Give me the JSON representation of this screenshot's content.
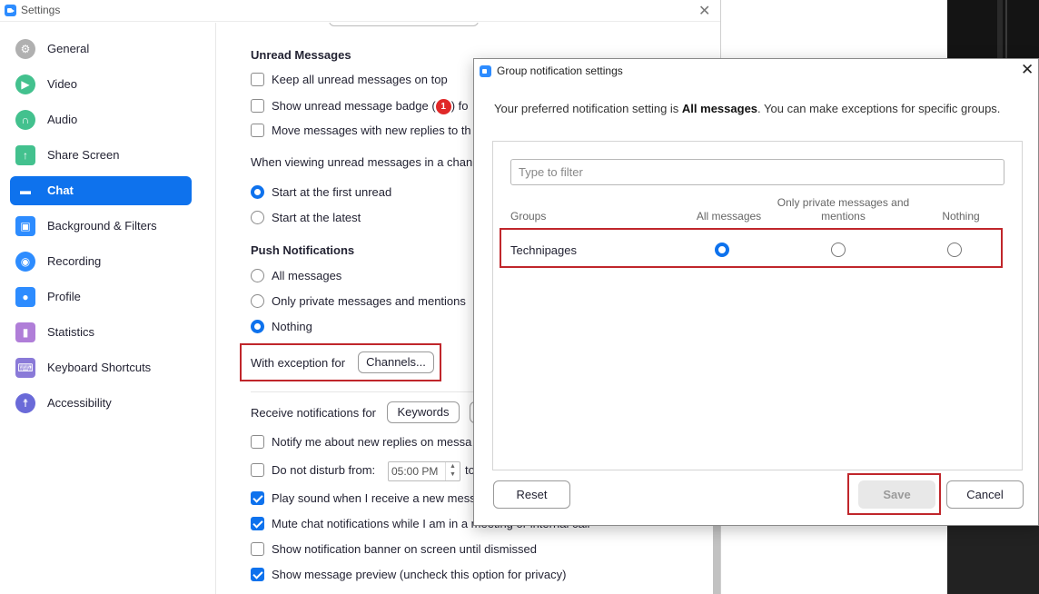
{
  "window": {
    "title": "Settings"
  },
  "sidebar": {
    "items": [
      {
        "label": "General",
        "icon": "gear-icon",
        "color": "#b0b0b0"
      },
      {
        "label": "Video",
        "icon": "video-icon",
        "color": "#43c18e"
      },
      {
        "label": "Audio",
        "icon": "headphones-icon",
        "color": "#43c18e"
      },
      {
        "label": "Share Screen",
        "icon": "share-screen-icon",
        "color": "#43c18e"
      },
      {
        "label": "Chat",
        "icon": "chat-icon",
        "color": "#ffffff"
      },
      {
        "label": "Background & Filters",
        "icon": "background-icon",
        "color": "#2d8cff"
      },
      {
        "label": "Recording",
        "icon": "recording-icon",
        "color": "#2d8cff"
      },
      {
        "label": "Profile",
        "icon": "profile-icon",
        "color": "#2d8cff"
      },
      {
        "label": "Statistics",
        "icon": "statistics-icon",
        "color": "#b07ed8"
      },
      {
        "label": "Keyboard Shortcuts",
        "icon": "keyboard-icon",
        "color": "#8a7ad8"
      },
      {
        "label": "Accessibility",
        "icon": "accessibility-icon",
        "color": "#6a6ad8"
      }
    ],
    "active_index": 4,
    "active_color": "#0e72ed"
  },
  "chat": {
    "unread_title": "Unread Messages",
    "keep_unread": "Keep all unread messages on top",
    "badge_pre": "Show unread message badge (",
    "badge_count": "1",
    "badge_post": ") fo",
    "move_messages": "Move messages with new replies to th",
    "when_viewing": "When viewing unread messages in a chann",
    "start_first": "Start at the first unread",
    "start_latest": "Start at the latest",
    "push_title": "Push Notifications",
    "push_all": "All messages",
    "push_private": "Only private messages and mentions",
    "push_nothing": "Nothing",
    "exception_label": "With exception for",
    "channels_button": "Channels...",
    "receive_label": "Receive notifications for",
    "keywords_button": "Keywords",
    "notify_replies": "Notify me about new replies on messa",
    "dnd_label": "Do not disturb from:",
    "dnd_time": "05:00 PM",
    "dnd_to": "to",
    "play_sound": "Play sound when I receive a new messa",
    "mute_chat": "Mute chat notifications while I am in a meeting or internal call",
    "show_banner": "Show notification banner on screen until dismissed",
    "show_preview": "Show message preview (uncheck this option for privacy)"
  },
  "dialog": {
    "title": "Group notification settings",
    "pref_prefix": "Your preferred notification setting is ",
    "pref_bold": "All messages",
    "pref_suffix": ". You can make exceptions for specific groups.",
    "filter_placeholder": "Type to filter",
    "col_groups": "Groups",
    "col_all": "All messages",
    "col_private": "Only private messages and mentions",
    "col_nothing": "Nothing",
    "group_name": "Technipages",
    "reset_button": "Reset",
    "save_button": "Save",
    "cancel_button": "Cancel"
  },
  "colors": {
    "accent": "#0e72ed",
    "highlight": "#c0262b"
  }
}
